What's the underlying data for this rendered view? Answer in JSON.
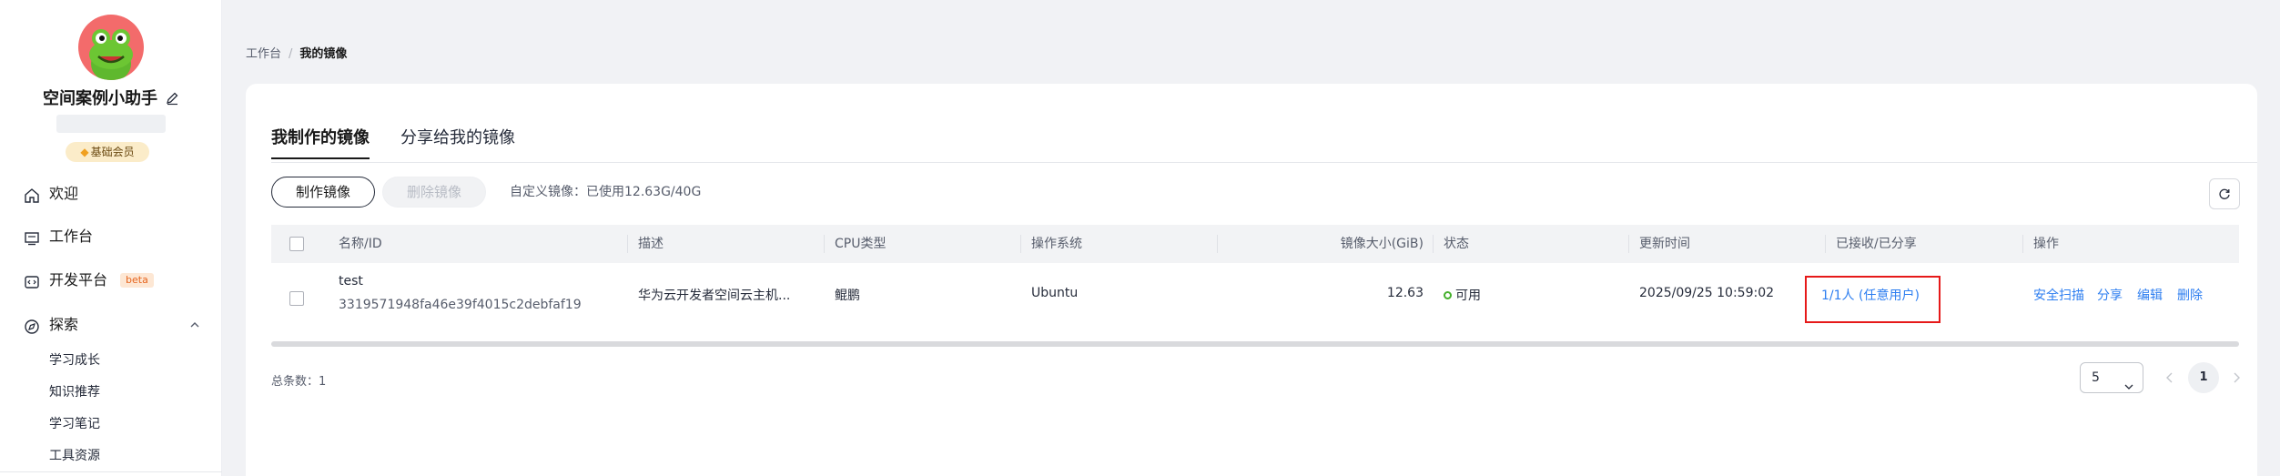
{
  "sidebar": {
    "user_name": "空间案例小助手",
    "member_badge": "基础会员",
    "nav": [
      {
        "label": "欢迎",
        "icon": "home-icon"
      },
      {
        "label": "工作台",
        "icon": "workbench-icon"
      },
      {
        "label": "开发平台",
        "icon": "code-icon",
        "badge": "beta"
      },
      {
        "label": "探索",
        "icon": "explore-icon"
      }
    ],
    "explore_sub": [
      "学习成长",
      "知识推荐",
      "学习笔记",
      "工具资源"
    ]
  },
  "breadcrumb": {
    "root": "工作台",
    "separator": "/",
    "current": "我的镜像"
  },
  "tabs": [
    "我制作的镜像",
    "分享给我的镜像"
  ],
  "toolbar": {
    "create_label": "制作镜像",
    "delete_label": "删除镜像",
    "quota_text": "自定义镜像：已使用12.63G/40G"
  },
  "table": {
    "columns": [
      "名称/ID",
      "描述",
      "CPU类型",
      "操作系统",
      "镜像大小(GiB)",
      "状态",
      "更新时间",
      "已接收/已分享",
      "操作"
    ],
    "rows": [
      {
        "name": "test",
        "id": "3319571948fa46e39f4015c2debfaf19",
        "description": "华为云开发者空间云主机...",
        "cpu": "鲲鹏",
        "os": "Ubuntu",
        "size": "12.63",
        "status": "可用",
        "updated": "2025/09/25 10:59:02",
        "shared": "1/1人 (任意用户)",
        "actions": [
          "安全扫描",
          "分享",
          "编辑",
          "删除"
        ]
      }
    ]
  },
  "footer": {
    "total": "总条数：1",
    "page_size": "5",
    "current_page": "1"
  },
  "colors": {
    "accent": "#2d7ef0",
    "status_ok": "#45b02c",
    "highlight": "#e61919"
  }
}
